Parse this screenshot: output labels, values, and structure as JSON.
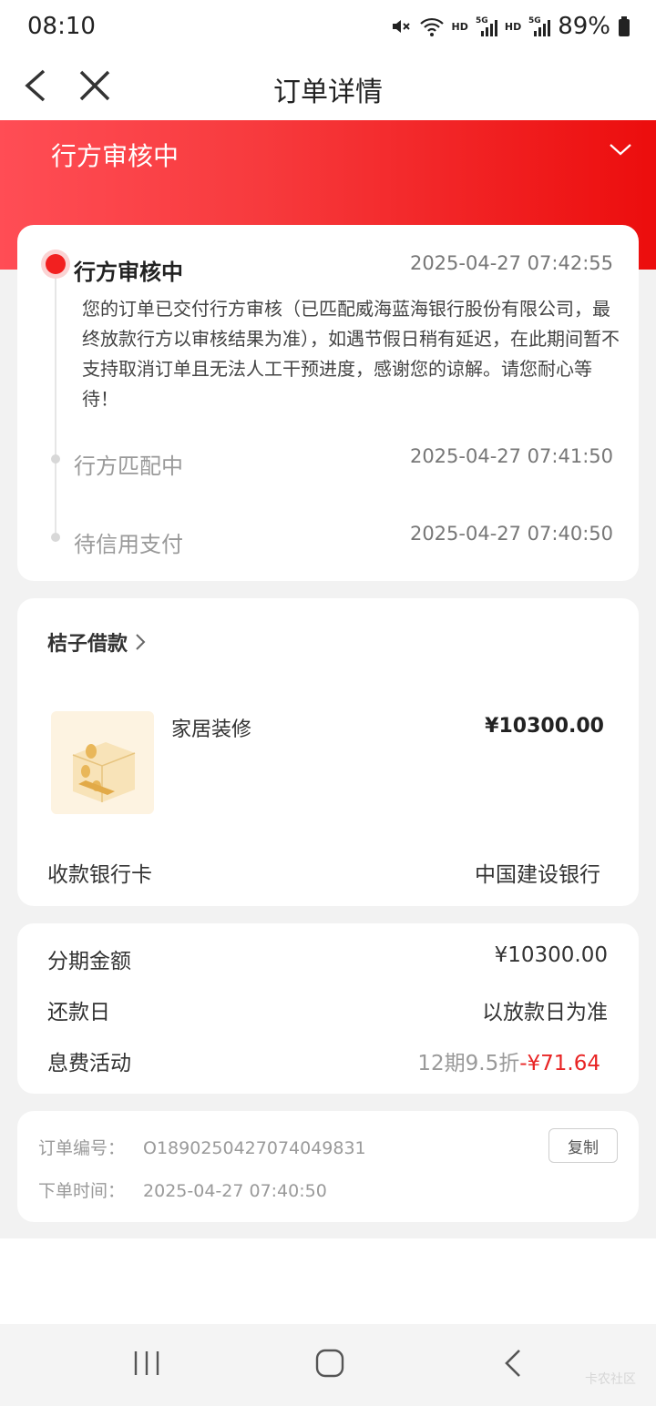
{
  "status_bar": {
    "time": "08:10",
    "battery": "89%",
    "hd_label": "HD",
    "network": "5G"
  },
  "nav": {
    "title": "订单详情"
  },
  "banner": {
    "status": "行方审核中"
  },
  "timeline": [
    {
      "title": "行方审核中",
      "time": "2025-04-27 07:42:55",
      "desc": "您的订单已交付行方审核（已匹配威海蓝海银行股份有限公司，最终放款行方以审核结果为准），如遇节假日稍有延迟，在此期间暂不支持取消订单且无法人工干预进度，感谢您的谅解。请您耐心等待！"
    },
    {
      "title": "行方匹配中",
      "time": "2025-04-27 07:41:50"
    },
    {
      "title": "待信用支付",
      "time": "2025-04-27 07:40:50"
    }
  ],
  "product": {
    "merchant": "桔子借款",
    "name": "家居装修",
    "price": "¥10300.00",
    "bank_label": "收款银行卡",
    "bank_value": "中国建设银行"
  },
  "installment": {
    "amount_label": "分期金额",
    "amount_value": "¥10300.00",
    "repay_label": "还款日",
    "repay_value": "以放款日为准",
    "promo_label": "息费活动",
    "promo_text": "12期9.5折",
    "promo_discount": "-¥71.64"
  },
  "order": {
    "number_label": "订单编号：",
    "number_value": "O1890250427074049831",
    "time_label": "下单时间：",
    "time_value": "2025-04-27 07:40:50",
    "copy_label": "复制"
  },
  "watermark": "卡农社区",
  "colors": {
    "accent": "#ec0d0d",
    "banner_start": "#ff4d55",
    "discount": "#e82424"
  }
}
